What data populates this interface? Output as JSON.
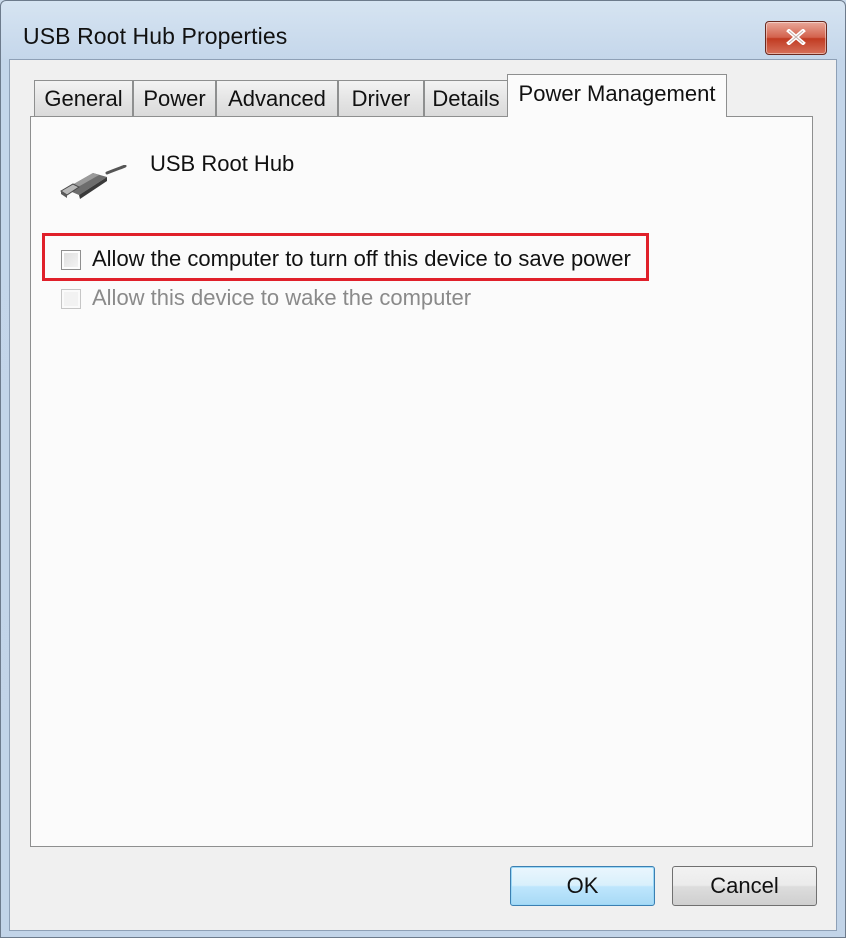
{
  "window": {
    "title": "USB Root Hub Properties",
    "close_icon": "close-x-icon"
  },
  "tabs": [
    {
      "label": "General",
      "active": false
    },
    {
      "label": "Power",
      "active": false
    },
    {
      "label": "Advanced",
      "active": false
    },
    {
      "label": "Driver",
      "active": false
    },
    {
      "label": "Details",
      "active": false
    },
    {
      "label": "Power Management",
      "active": true
    }
  ],
  "device": {
    "icon": "usb-connector-icon",
    "name": "USB Root Hub"
  },
  "options": [
    {
      "label": "Allow the computer to turn off this device to save power",
      "checked": false,
      "enabled": true,
      "highlighted": true
    },
    {
      "label": "Allow this device to wake the computer",
      "checked": false,
      "enabled": false,
      "highlighted": false
    }
  ],
  "buttons": {
    "ok_label": "OK",
    "cancel_label": "Cancel"
  },
  "colors": {
    "highlight_border": "#e0202a",
    "close_button": "#c13b22",
    "default_button_border": "#3c7fb1"
  }
}
